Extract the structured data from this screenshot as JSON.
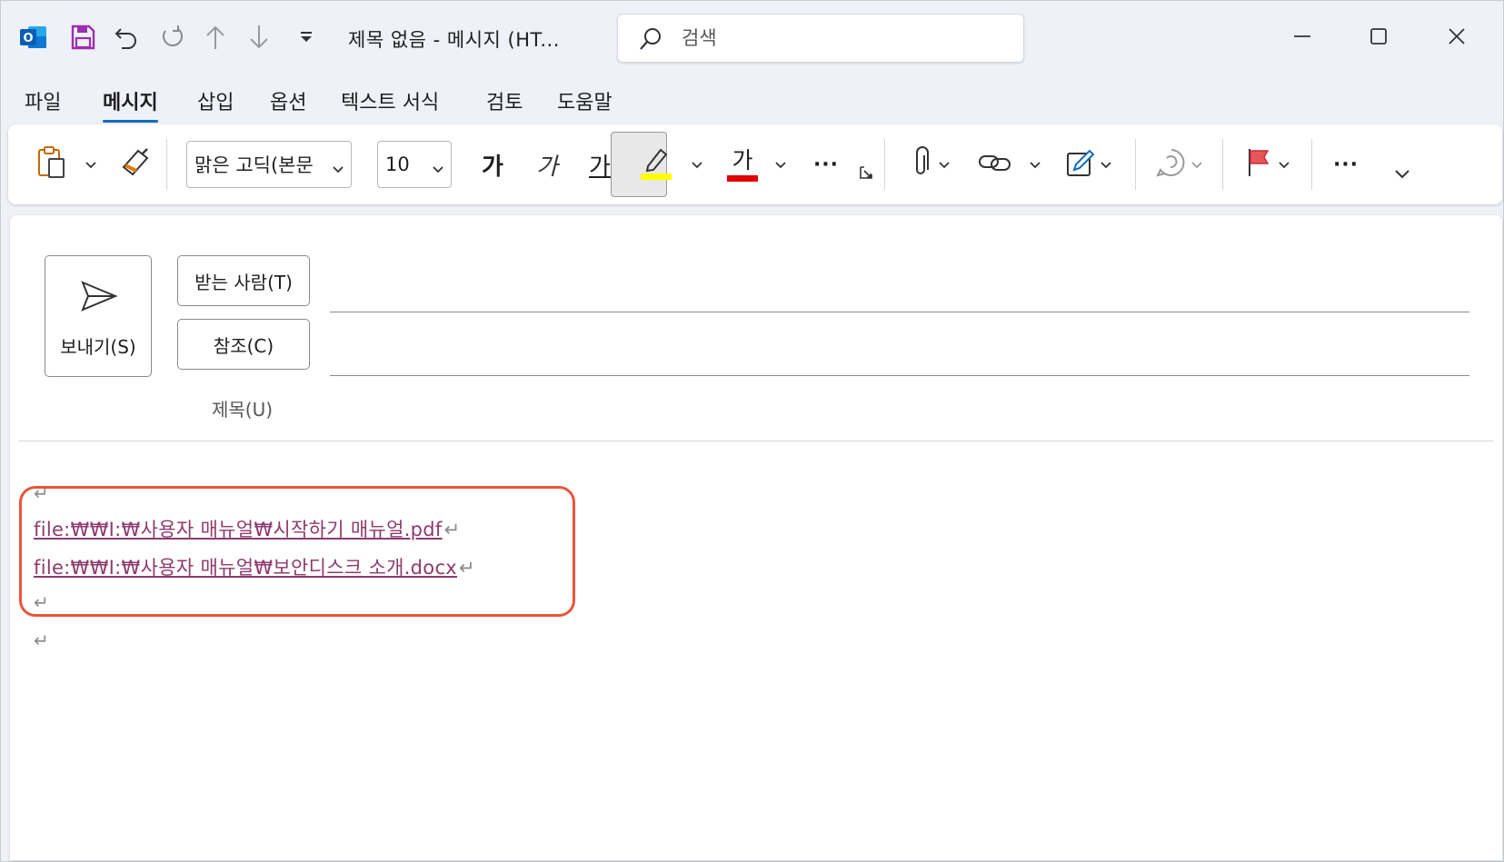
{
  "window": {
    "title": "제목 없음  -  메시지 (HT...",
    "search_placeholder": "검색"
  },
  "tabs": [
    "파일",
    "메시지",
    "삽입",
    "옵션",
    "텍스트 서식",
    "검토",
    "도움말"
  ],
  "active_tab": "메시지",
  "ribbon": {
    "font_name": "맑은 고딕(본문",
    "font_size": "10",
    "bold_label": "가",
    "italic_label": "가",
    "underline_label": "가",
    "font_color_label": "가",
    "more_label": "···",
    "overflow_label": "···"
  },
  "compose": {
    "send_label": "보내기(S)",
    "to_label": "받는 사람(T)",
    "cc_label": "참조(C)",
    "subject_label": "제목(U)",
    "to_value": "",
    "cc_value": "",
    "subject_value": ""
  },
  "body": {
    "paragraph_mark": "↵",
    "links": [
      "file:₩₩I:₩사용자 매뉴얼₩시작하기 매뉴얼.pdf",
      "file:₩₩I:₩사용자 매뉴얼₩보안디스크 소개.docx"
    ]
  },
  "colors": {
    "accent": "#0f6cbd",
    "highlight_box": "#e8553a",
    "link": "#8e3b6e",
    "highlight_marker": "#ffff00",
    "font_color_marker": "#e00000"
  }
}
